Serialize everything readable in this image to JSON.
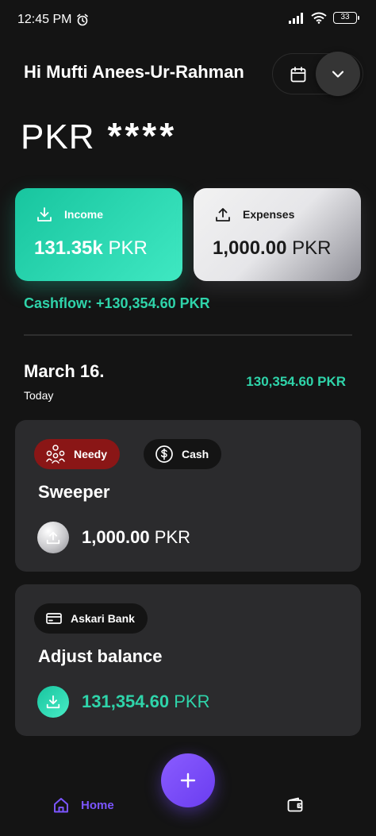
{
  "status_bar": {
    "time": "12:45 PM",
    "battery": "33"
  },
  "header": {
    "greeting": "Hi Mufti Anees-Ur-Rahman"
  },
  "balance": {
    "currency": "PKR",
    "masked": "****"
  },
  "income_card": {
    "label": "Income",
    "amount": "131.35k",
    "unit": "PKR",
    "color": "#1ed4aa"
  },
  "expense_card": {
    "label": "Expenses",
    "amount": "1,000.00",
    "unit": "PKR"
  },
  "cashflow": {
    "text": "Cashflow: +130,354.60 PKR",
    "color": "#2fd4aa"
  },
  "day_group": {
    "date": "March 16.",
    "relative": "Today",
    "total": "130,354.60 PKR"
  },
  "transactions": [
    {
      "category": "Needy",
      "category_color": "#8a1616",
      "account": "Cash",
      "title": "Sweeper",
      "amount": "1,000.00",
      "unit": "PKR",
      "type": "expense"
    },
    {
      "account": "Askari Bank",
      "title": "Adjust balance",
      "amount": "131,354.60",
      "unit": "PKR",
      "type": "income",
      "amount_color": "#2fd4aa"
    }
  ],
  "bottom_nav": {
    "home_label": "Home",
    "accent": "#7b55ff"
  },
  "icons": [
    "alarm-icon",
    "signal-icon",
    "wifi-icon",
    "battery-icon",
    "calendar-icon",
    "chevron-down-icon",
    "download-icon",
    "upload-icon",
    "people-icon",
    "dollar-coin-icon",
    "bank-card-icon",
    "plus-icon",
    "home-icon",
    "wallet-icon"
  ]
}
